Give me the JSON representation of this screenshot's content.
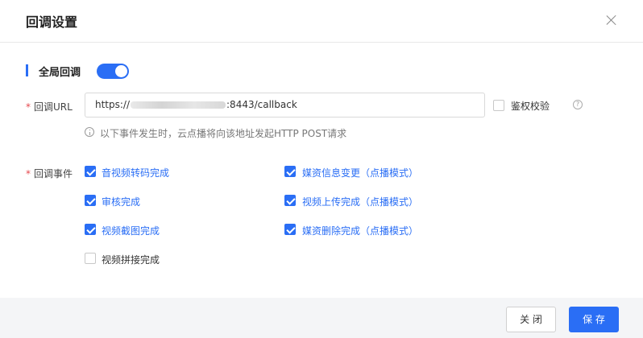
{
  "dialog": {
    "title": "回调设置"
  },
  "global_callback": {
    "label": "全局回调",
    "enabled": true
  },
  "url_field": {
    "required_mark": "*",
    "label": "回调URL",
    "value_prefix": "https://",
    "value_suffix": ":8443/callback"
  },
  "auth_check": {
    "label": "鉴权校验",
    "checked": false,
    "help_icon": "question-circle-icon"
  },
  "hint": {
    "icon": "info-circle-icon",
    "text": "以下事件发生时，云点播将向该地址发起HTTP POST请求"
  },
  "events": {
    "required_mark": "*",
    "label": "回调事件",
    "items": [
      {
        "label": "音视频转码完成",
        "checked": true
      },
      {
        "label": "审核完成",
        "checked": true
      },
      {
        "label": "视频截图完成",
        "checked": true
      },
      {
        "label": "视频拼接完成",
        "checked": false
      },
      {
        "label": "媒资信息变更（点播模式）",
        "checked": true
      },
      {
        "label": "视频上传完成（点播模式）",
        "checked": true
      },
      {
        "label": "媒资删除完成（点播模式）",
        "checked": true
      }
    ]
  },
  "footer": {
    "close_label": "关 闭",
    "save_label": "保 存"
  },
  "colors": {
    "accent": "#2a6ef5",
    "required": "#e5484d",
    "footer_bg": "#f4f5f7"
  }
}
